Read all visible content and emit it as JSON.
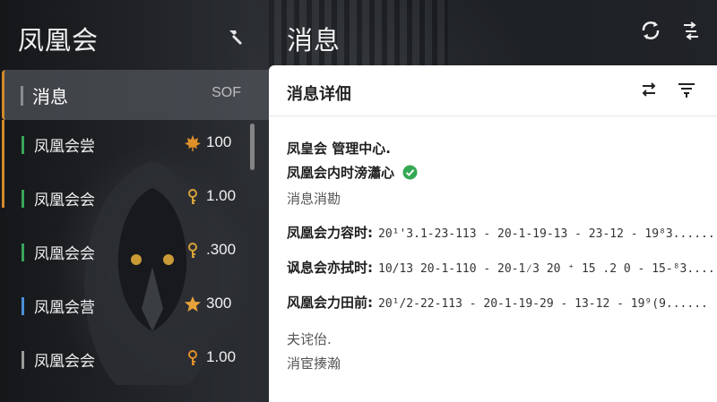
{
  "app": {
    "title": "凤凰会"
  },
  "header": {
    "title": "消息"
  },
  "sidebar": {
    "header": {
      "label": "消息",
      "tag": "SOF"
    },
    "items": [
      {
        "label": "凤凰会尝",
        "value": "100",
        "icon": "maple-leaf-icon",
        "mark_color": "#3aa55c",
        "icon_color": "#e0902a"
      },
      {
        "label": "凤凰会会",
        "value": "1.00",
        "icon": "key-icon",
        "mark_color": "#3aa55c",
        "icon_color": "#d8a23a"
      },
      {
        "label": "凤凰会会",
        "value": ".300",
        "icon": "key-icon",
        "mark_color": "#3aa55c",
        "icon_color": "#d8a23a"
      },
      {
        "label": "凤凰会营",
        "value": "300",
        "icon": "star-icon",
        "mark_color": "#4a90d6",
        "icon_color": "#e8a23a"
      },
      {
        "label": "凤凰会会",
        "value": "1.00",
        "icon": "key-icon",
        "mark_color": "#9a9a9a",
        "icon_color": "#e0902a"
      }
    ]
  },
  "detail": {
    "title": "消息详佃",
    "line1": "凤皇会 管理中心.",
    "line2": "凤凰会内时滂瀟心",
    "line3": "消息消勘",
    "rows": [
      {
        "key": "凤凰会力容时:",
        "value": "20¹'3.1-23-113 - 20-1-19-13 - 23-12 - 19⁸3......"
      },
      {
        "key": "讽息会亦拭时:",
        "value": "10/13 20-1-110 - 20-1⁄3 20 ⁺ 15 .2 0 - 15-⁸3......"
      },
      {
        "key": "风凰会力田前:",
        "value": "20¹/2-22-113 - 20-1-19-29 - 13-12 - 19⁹(9......"
      }
    ],
    "line4": "夫诧佁.",
    "line5": "消宦揍瀚"
  },
  "colors": {
    "accent": "#d08a2c",
    "success": "#35a853"
  }
}
